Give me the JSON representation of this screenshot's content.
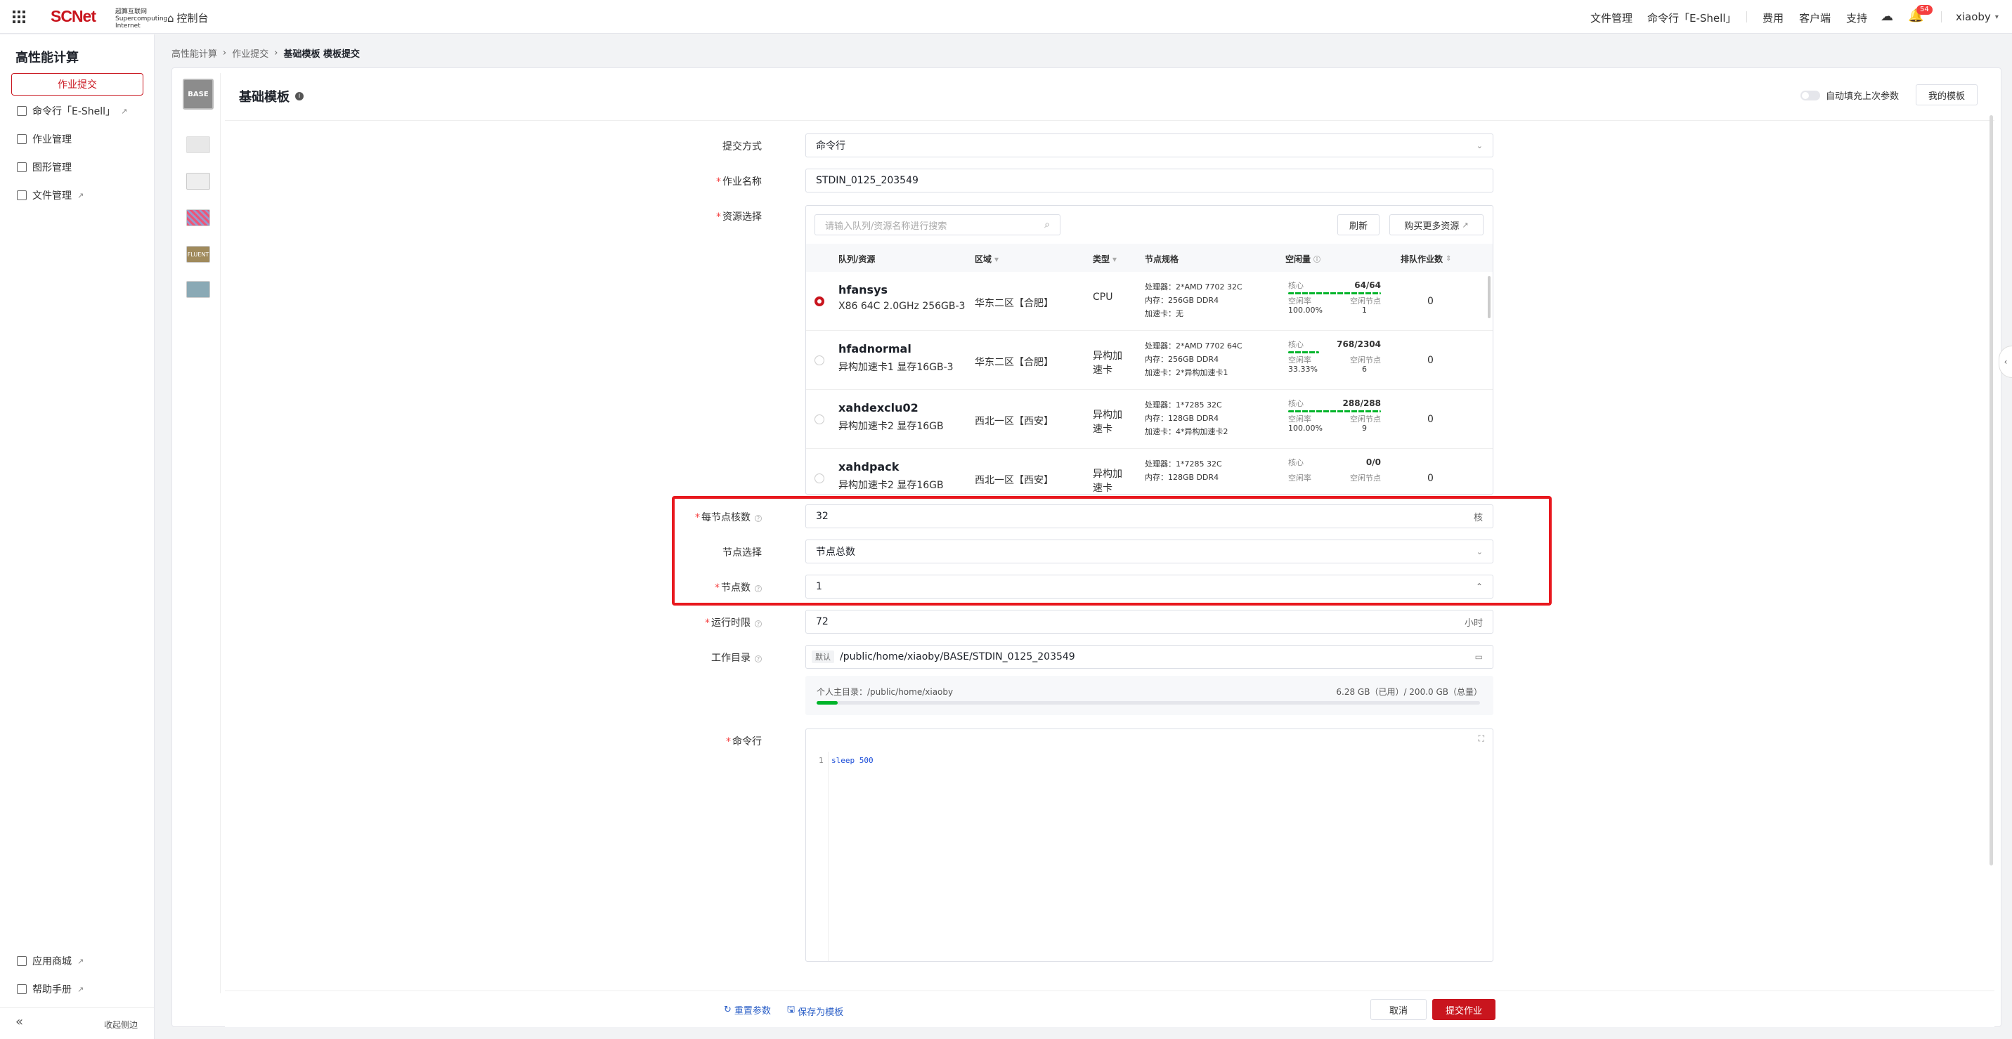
{
  "header": {
    "logo_text": "SCNet",
    "logo_sub": "超算互联网 Supercomputing Internet",
    "console": "控制台",
    "right_items": [
      "文件管理",
      "命令行「E-Shell」",
      "费用",
      "客户端",
      "支持"
    ],
    "notification_count": "54",
    "user": "xiaoby"
  },
  "sidebar": {
    "title": "高性能计算",
    "active_button": "作业提交",
    "items": [
      {
        "label": "命令行「E-Shell」",
        "icon": "terminal-icon",
        "external": true
      },
      {
        "label": "作业管理",
        "icon": "task-icon",
        "external": false
      },
      {
        "label": "图形管理",
        "icon": "monitor-icon",
        "external": false
      },
      {
        "label": "文件管理",
        "icon": "folder-icon",
        "external": true
      }
    ],
    "bottom_items": [
      {
        "label": "应用商城",
        "icon": "store-icon"
      },
      {
        "label": "帮助手册",
        "icon": "book-icon"
      }
    ],
    "collapse_label": "收起侧边",
    "collapse_icon": "double-chevron-left-icon"
  },
  "breadcrumb": [
    "高性能计算",
    "作业提交",
    "基础模板 模板提交"
  ],
  "template": {
    "thumb_label": "BASE",
    "title": "基础模板",
    "auto_fill_label": "自动填充上次参数",
    "my_templates": "我的模板",
    "thumb_labels": [
      "",
      "",
      "",
      "FLUENT",
      ""
    ]
  },
  "form": {
    "submit_mode": {
      "label": "提交方式",
      "value": "命令行"
    },
    "job_name": {
      "label": "作业名称",
      "value": "STDIN_0125_203549"
    },
    "resource": {
      "label": "资源选择",
      "search_placeholder": "请输入队列/资源名称进行搜索",
      "refresh": "刷新",
      "buy_more": "购买更多资源",
      "columns": [
        "队列/资源",
        "区域",
        "类型",
        "节点规格",
        "空闲量",
        "排队作业数"
      ],
      "rows": [
        {
          "name": "hfansys",
          "sub": "X86 64C 2.0GHz 256GB-3",
          "region": "华东二区【合肥】",
          "type": "CPU",
          "spec": [
            "处理器：2*AMD 7702 32C",
            "内存：256GB DDR4",
            "加速卡：无"
          ],
          "core_label": "核心",
          "cores": "64/64",
          "idle_label": "空闲率",
          "idle": "100.00%",
          "free_node_label": "空闲节点",
          "free_nodes": "1",
          "bar_pct": 100,
          "queue": "0",
          "selected": true
        },
        {
          "name": "hfadnormal",
          "sub": "异构加速卡1 显存16GB-3",
          "region": "华东二区【合肥】",
          "type": "异构加速卡",
          "spec": [
            "处理器：2*AMD 7702 64C",
            "内存：256GB DDR4",
            "加速卡：2*异构加速卡1"
          ],
          "core_label": "核心",
          "cores": "768/2304",
          "idle_label": "空闲率",
          "idle": "33.33%",
          "free_node_label": "空闲节点",
          "free_nodes": "6",
          "bar_pct": 33.33,
          "queue": "0",
          "selected": false
        },
        {
          "name": "xahdexclu02",
          "sub": "异构加速卡2 显存16GB",
          "region": "西北一区【西安】",
          "type": "异构加速卡",
          "spec": [
            "处理器：1*7285 32C",
            "内存：128GB DDR4",
            "加速卡：4*异构加速卡2"
          ],
          "core_label": "核心",
          "cores": "288/288",
          "idle_label": "空闲率",
          "idle": "100.00%",
          "free_node_label": "空闲节点",
          "free_nodes": "9",
          "bar_pct": 100,
          "queue": "0",
          "selected": false
        },
        {
          "name": "xahdpack",
          "sub": "异构加速卡2 显存16GB",
          "region": "西北一区【西安】",
          "type": "异构加速卡",
          "spec": [
            "处理器：1*7285 32C",
            "内存：128GB DDR4",
            ""
          ],
          "core_label": "核心",
          "cores": "0/0",
          "idle_label": "空闲率",
          "idle": "",
          "free_node_label": "空闲节点",
          "free_nodes": "",
          "bar_pct": 0,
          "queue": "0",
          "selected": false
        }
      ]
    },
    "cores_per_node": {
      "label": "每节点核数",
      "value": "32",
      "unit": "核"
    },
    "node_select": {
      "label": "节点选择",
      "value": "节点总数"
    },
    "node_count": {
      "label": "节点数",
      "value": "1"
    },
    "time_limit": {
      "label": "运行时限",
      "value": "72",
      "unit": "小时"
    },
    "work_dir": {
      "label": "工作目录",
      "tag": "默认",
      "value": "/public/home/xiaoby/BASE/STDIN_0125_203549",
      "home_label": "个人主目录：/public/home/xiaoby",
      "usage": "6.28 GB（已用）/ 200.0 GB（总量）",
      "usage_pct": 3.14
    },
    "command": {
      "label": "命令行",
      "line_no": "1",
      "code": "sleep 500"
    }
  },
  "footer": {
    "reset": "重置参数",
    "save_template": "保存为模板",
    "cancel": "取消",
    "submit": "提交作业"
  },
  "colors": {
    "brand": "#c9151e",
    "success": "#00b42a",
    "highlight": "#e8181e"
  }
}
